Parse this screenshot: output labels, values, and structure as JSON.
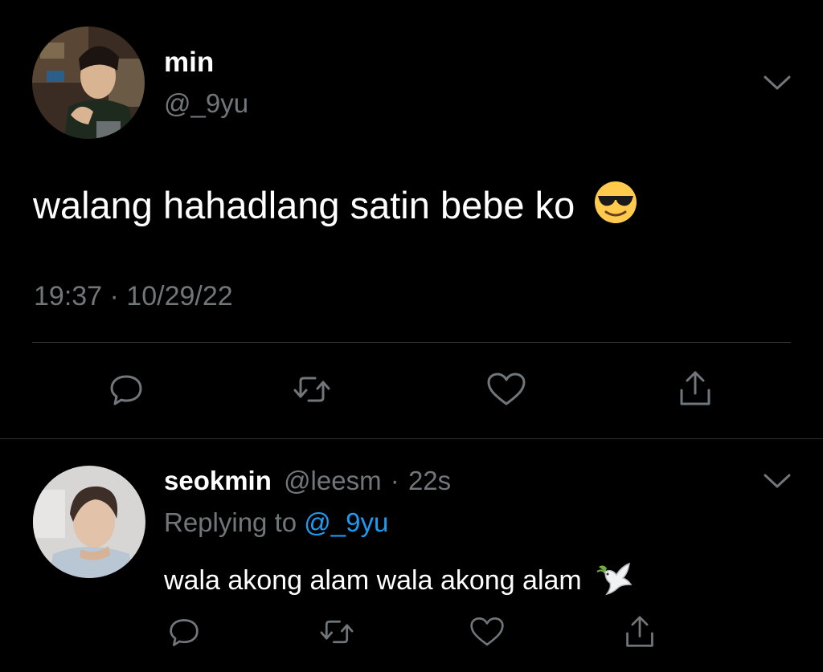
{
  "main_tweet": {
    "author_name": "min",
    "author_handle": "@_9yu",
    "text": "walang hahadlang satin bebe ko",
    "emoji": "smiling-face-with-sunglasses",
    "timestamp": "19:37 · 10/29/22",
    "actions": [
      "reply-icon",
      "retweet-icon",
      "like-icon",
      "share-icon"
    ],
    "more_icon": "chevron-down-icon"
  },
  "reply_tweet": {
    "author_name": "seokmin",
    "author_handle": "@leesm",
    "separator": "·",
    "time_ago": "22s",
    "replying_prefix": "Replying to",
    "replying_handle": "@_9yu",
    "text": "wala akong alam wala akong alam",
    "emoji": "dove",
    "actions": [
      "reply-icon",
      "retweet-icon",
      "like-icon",
      "share-icon"
    ],
    "more_icon": "chevron-down-icon"
  },
  "colors": {
    "background": "#000000",
    "primary_text": "#ffffff",
    "secondary_text": "#71767b",
    "link": "#1d9bf0",
    "divider": "#2f3336"
  }
}
